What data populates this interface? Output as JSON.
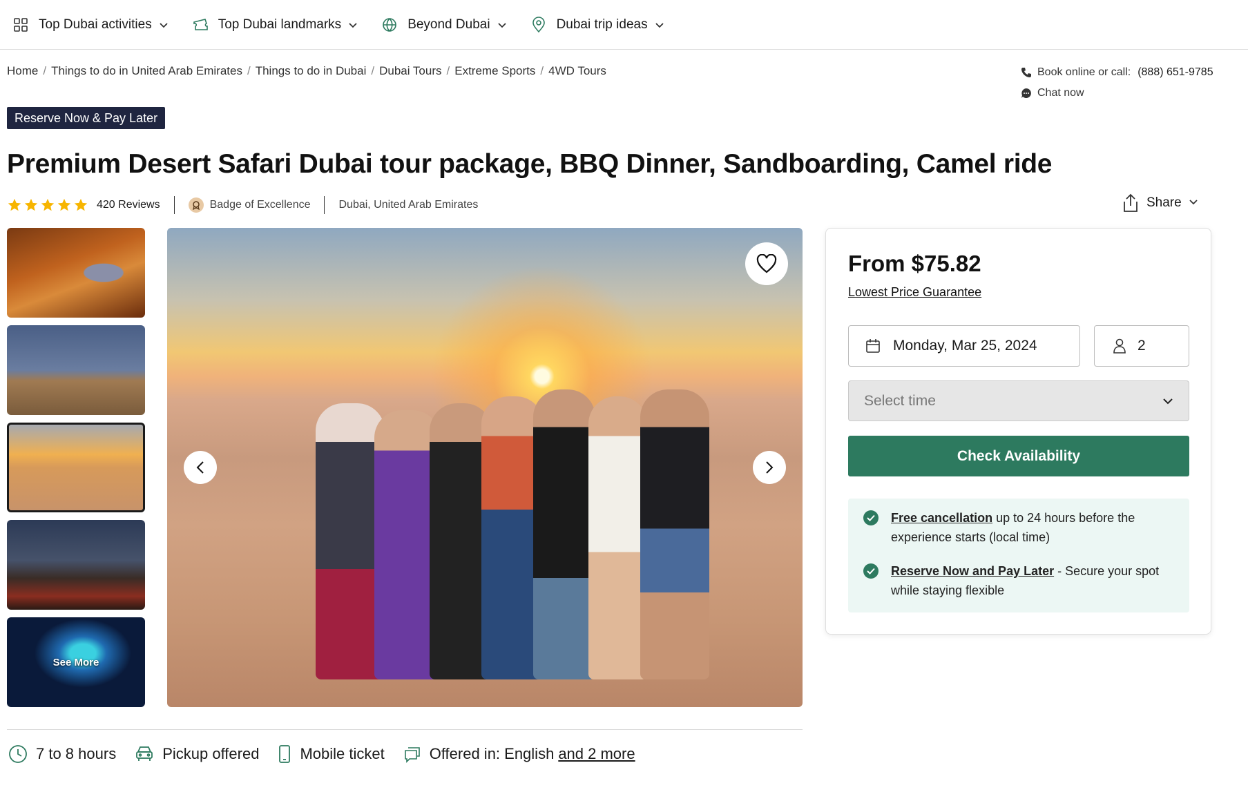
{
  "nav": {
    "items": [
      {
        "label": "Top Dubai activities",
        "icon": "grid-icon"
      },
      {
        "label": "Top Dubai landmarks",
        "icon": "ticket-icon"
      },
      {
        "label": "Beyond Dubai",
        "icon": "globe-icon"
      },
      {
        "label": "Dubai trip ideas",
        "icon": "map-pin-icon"
      }
    ]
  },
  "breadcrumb": [
    "Home",
    "Things to do in United Arab Emirates",
    "Things to do in Dubai",
    "Dubai Tours",
    "Extreme Sports",
    "4WD Tours"
  ],
  "contact": {
    "book_label": "Book online or call:",
    "phone": "(888) 651-9785",
    "chat": "Chat now"
  },
  "badge": "Reserve Now & Pay Later",
  "title": "Premium Desert Safari Dubai tour package, BBQ Dinner, Sandboarding, Camel ride",
  "rating": {
    "stars": 5,
    "reviews": "420 Reviews",
    "excellence": "Badge of Excellence",
    "location": "Dubai, United Arab Emirates"
  },
  "share": "Share",
  "gallery": {
    "see_more": "See More",
    "active_index": 2
  },
  "booking": {
    "price": "From $75.82",
    "guarantee": "Lowest Price Guarantee",
    "date": "Monday, Mar 25, 2024",
    "travelers": "2",
    "time_placeholder": "Select time",
    "cta": "Check Availability",
    "perk1_link": "Free cancellation",
    "perk1_text": " up to 24 hours before the experience starts (local time)",
    "perk2_link": "Reserve Now and Pay Later",
    "perk2_text": " - Secure your spot while staying flexible"
  },
  "features": {
    "duration": "7 to 8 hours",
    "pickup": "Pickup offered",
    "ticket": "Mobile ticket",
    "language": "Offered in: English",
    "language_more": "and 2 more"
  },
  "colors": {
    "accent_green": "#2d7a5f",
    "badge_navy": "#1f2540",
    "star_yellow": "#f7b500",
    "perk_bg": "#ecf7f4"
  }
}
